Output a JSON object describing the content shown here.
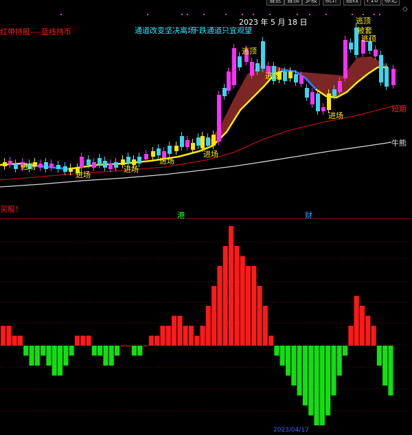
{
  "toolbar": {
    "tabs": [
      "叠区",
      "叠加",
      "多股",
      "统计",
      "画线",
      "F10",
      "标记"
    ],
    "diamond_icon": "diamond-icon"
  },
  "top_panel": {
    "left_note": "红带持股----蓝线持币",
    "center_note_part1": "通道改变坚决离场",
    "center_note_part2": "下跌通道只宜观望",
    "date_label": "2023 年 5 月 18 日",
    "signal_labels": [
      "逃顶",
      "逃顶",
      "诱多",
      "被套",
      "逃顶",
      "卖出"
    ],
    "entry_label": "进场",
    "short_line_label": "短期",
    "bull_bear_label": "牛熊",
    "colors": {
      "up_candle": "#ff30ff",
      "down_candle": "#3ad6f0",
      "yellow_candle": "#ffe600",
      "ribbon": "#8b2a2a",
      "yellow_line": "#ffee00",
      "blue_line": "#1f78ff",
      "red_line": "#b01010",
      "white_line": "#d8d8d8"
    }
  },
  "divider_texts": {
    "left": "买股！",
    "mid1": "港",
    "mid2": "财"
  },
  "bottom_panel": {
    "colors": {
      "positive": "#ff1a1a",
      "negative": "#10e010"
    },
    "bottom_date": "2023/04/17"
  },
  "chart_data": [
    {
      "type": "candlestick",
      "title": "",
      "series": [
        {
          "name": "短期",
          "values": []
        },
        {
          "name": "牛熊",
          "values": []
        }
      ],
      "date_marker": "2023 年 5 月 18 日"
    },
    {
      "type": "bar",
      "title": "",
      "baseline": 0,
      "values": [
        2,
        2,
        1,
        1,
        -1,
        -2,
        -2,
        -1,
        -2,
        -3,
        -3,
        -2,
        -1,
        1,
        1,
        1,
        -1,
        -1,
        -2,
        -2,
        -1,
        0,
        0,
        -1,
        -1,
        0,
        1,
        1,
        2,
        2,
        3,
        3,
        2,
        2,
        1,
        2,
        4,
        6,
        8,
        10,
        12,
        10,
        9,
        8,
        8,
        6,
        4,
        1,
        -1,
        -2,
        -3,
        -4,
        -5,
        -6,
        -7,
        -8,
        -8,
        -7,
        -5,
        -3,
        -1,
        2,
        5,
        4,
        3,
        2,
        -2,
        -4,
        -5
      ]
    }
  ]
}
